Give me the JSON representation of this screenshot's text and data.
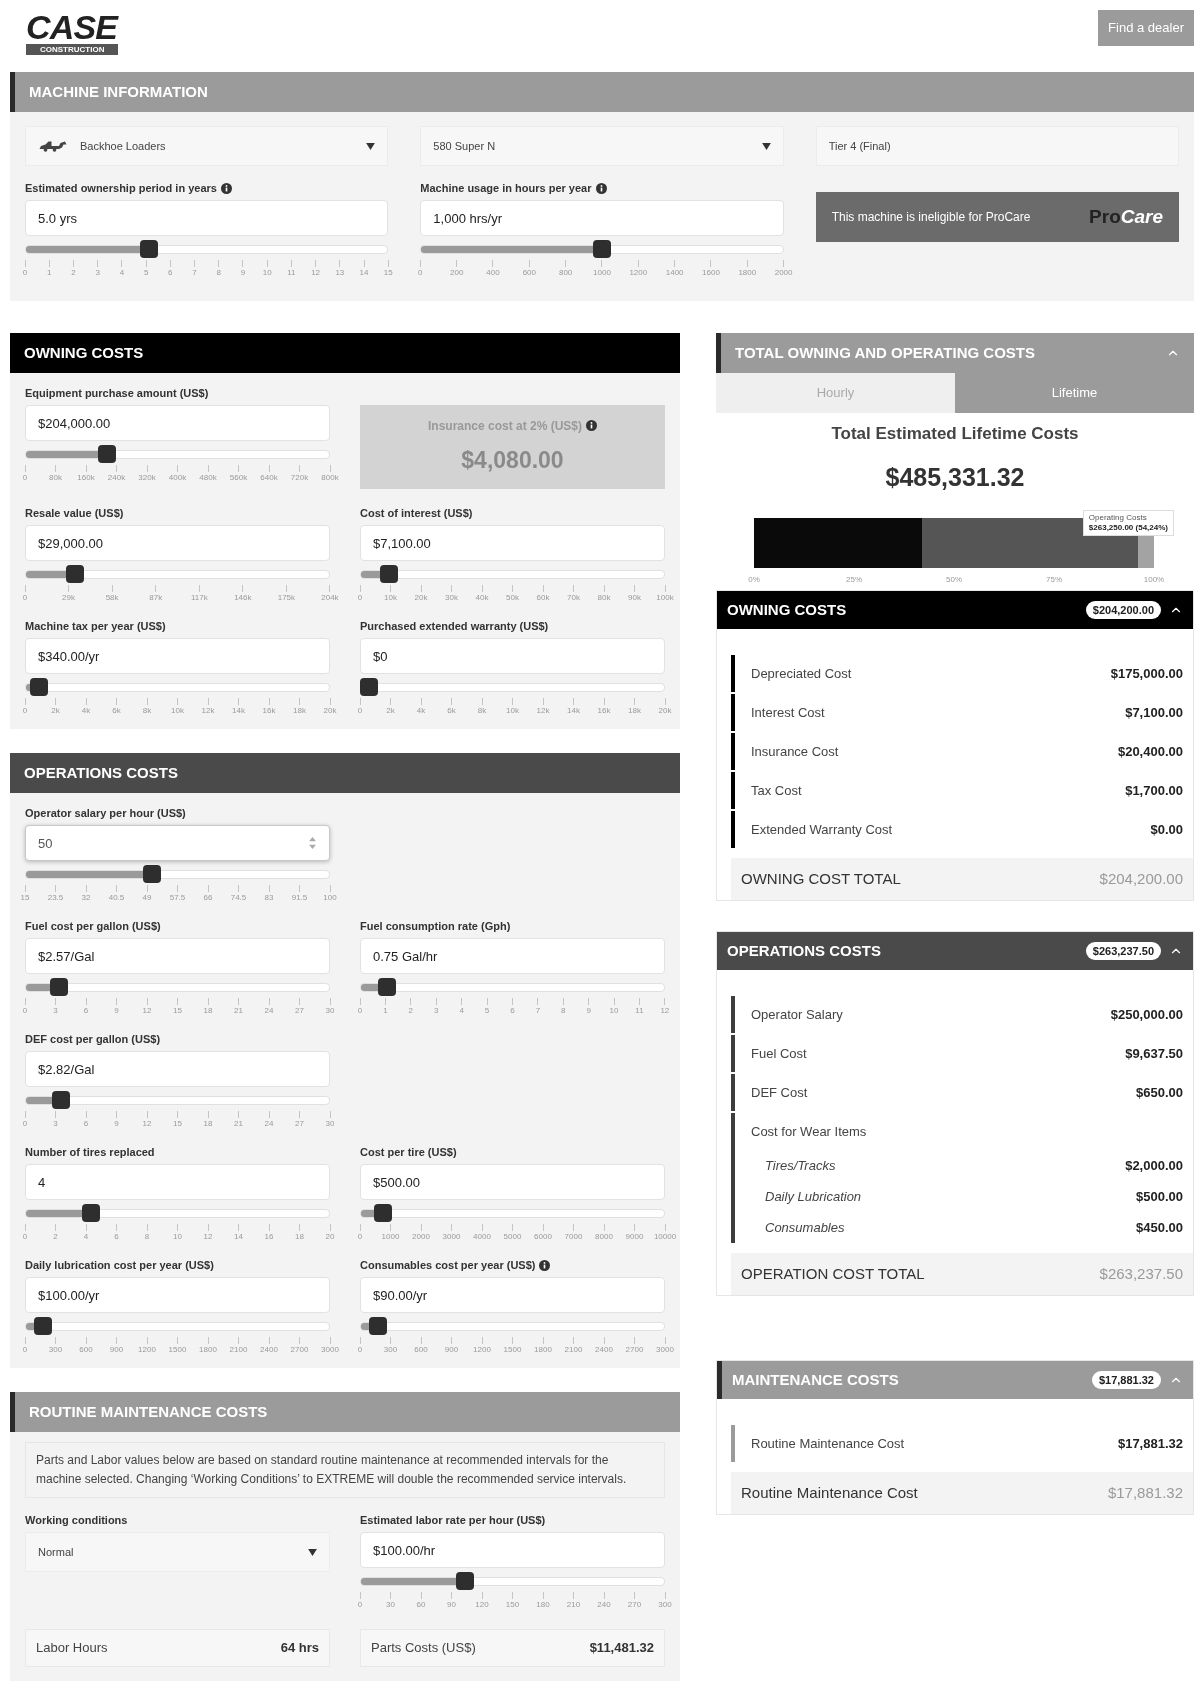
{
  "header": {
    "logo": {
      "name": "CASE",
      "tagline": "CONSTRUCTION"
    },
    "dealer_button": "Find a dealer"
  },
  "machine_information": {
    "title": "MACHINE INFORMATION",
    "kind": "gray",
    "selects": [
      {
        "kind": "category",
        "value": "Backhoe Loaders"
      },
      {
        "kind": "dropdown",
        "value": "580 Super N"
      },
      {
        "kind": "display",
        "value": "Tier 4 (Final)"
      }
    ],
    "fields": [
      {
        "kind": "text",
        "label": "Estimated ownership period in years",
        "info": true,
        "value": "5.0 yrs",
        "level": 0.333,
        "ticks": [
          "0",
          "1",
          "2",
          "3",
          "4",
          "5",
          "6",
          "7",
          "8",
          "9",
          "10",
          "11",
          "12",
          "13",
          "14",
          "15"
        ]
      },
      {
        "kind": "text",
        "label": "Machine usage in hours per year",
        "info": true,
        "value": "1,000 hrs/yr",
        "level": 0.5,
        "ticks": [
          "0",
          "200",
          "400",
          "600",
          "800",
          "1000",
          "1200",
          "1400",
          "1600",
          "1800",
          "2000"
        ]
      }
    ],
    "procare": {
      "message": "This machine is ineligible for ProCare",
      "logo_first": "Pro",
      "logo_second": "Care"
    }
  },
  "owning_costs": {
    "title": "OWNING COSTS",
    "kind": "black",
    "rows": [
      [
        {
          "kind": "text",
          "label": "Equipment purchase amount (US$)",
          "info": false,
          "value": "$204,000.00",
          "level": 0.255,
          "ticks": [
            "0",
            "80k",
            "160k",
            "240k",
            "320k",
            "400k",
            "480k",
            "560k",
            "640k",
            "720k",
            "800k"
          ]
        },
        {
          "kind": "insurance",
          "label": "Insurance cost at 2% (US$)",
          "info": true,
          "amount": "$4,080.00"
        }
      ],
      [
        {
          "kind": "text",
          "label": "Resale value (US$)",
          "info": false,
          "value": "$29,000.00",
          "level": 0.142,
          "ticks": [
            "0",
            "29k",
            "58k",
            "87k",
            "117k",
            "146k",
            "175k",
            "204k"
          ]
        },
        {
          "kind": "text",
          "label": "Cost of interest (US$)",
          "info": false,
          "value": "$7,100.00",
          "level": 0.071,
          "ticks": [
            "0",
            "10k",
            "20k",
            "30k",
            "40k",
            "50k",
            "60k",
            "70k",
            "80k",
            "90k",
            "100k"
          ]
        }
      ],
      [
        {
          "kind": "text",
          "label": "Machine tax per year (US$)",
          "info": false,
          "value": "$340.00/yr",
          "level": 0.017,
          "ticks": [
            "0",
            "2k",
            "4k",
            "6k",
            "8k",
            "10k",
            "12k",
            "14k",
            "16k",
            "18k",
            "20k"
          ]
        },
        {
          "kind": "text",
          "label": "Purchased extended warranty (US$)",
          "info": false,
          "value": "$0",
          "level": 0,
          "ticks": [
            "0",
            "2k",
            "4k",
            "6k",
            "8k",
            "10k",
            "12k",
            "14k",
            "16k",
            "18k",
            "20k"
          ]
        }
      ]
    ]
  },
  "operations_costs": {
    "title": "OPERATIONS COSTS",
    "kind": "dark",
    "rows": [
      [
        {
          "kind": "number",
          "label": "Operator salary per hour (US$)",
          "info": false,
          "value": "50",
          "level": 0.41,
          "ticks": [
            "15",
            "23.5",
            "32",
            "40.5",
            "49",
            "57.5",
            "66",
            "74.5",
            "83",
            "91.5",
            "100"
          ]
        }
      ],
      [
        {
          "kind": "text",
          "label": "Fuel cost per gallon (US$)",
          "info": false,
          "value": "$2.57/Gal",
          "level": 0.086,
          "ticks": [
            "0",
            "3",
            "6",
            "9",
            "12",
            "15",
            "18",
            "21",
            "24",
            "27",
            "30"
          ]
        },
        {
          "kind": "text",
          "label": "Fuel consumption rate (Gph)",
          "info": false,
          "value": "0.75 Gal/hr",
          "level": 0.0625,
          "ticks": [
            "0",
            "1",
            "2",
            "3",
            "4",
            "5",
            "6",
            "7",
            "8",
            "9",
            "10",
            "11",
            "12"
          ]
        }
      ],
      [
        {
          "kind": "text",
          "label": "DEF cost per gallon (US$)",
          "info": false,
          "value": "$2.82/Gal",
          "level": 0.094,
          "ticks": [
            "0",
            "3",
            "6",
            "9",
            "12",
            "15",
            "18",
            "21",
            "24",
            "27",
            "30"
          ]
        }
      ],
      [
        {
          "kind": "text",
          "label": "Number of tires replaced",
          "info": false,
          "value": "4",
          "level": 0.2,
          "ticks": [
            "0",
            "2",
            "4",
            "6",
            "8",
            "10",
            "12",
            "14",
            "16",
            "18",
            "20"
          ]
        },
        {
          "kind": "text",
          "label": "Cost per tire (US$)",
          "info": false,
          "value": "$500.00",
          "level": 0.05,
          "ticks": [
            "0",
            "1000",
            "2000",
            "3000",
            "4000",
            "5000",
            "6000",
            "7000",
            "8000",
            "9000",
            "10000"
          ]
        }
      ],
      [
        {
          "kind": "text",
          "label": "Daily lubrication cost per year (US$)",
          "info": false,
          "value": "$100.00/yr",
          "level": 0.033,
          "ticks": [
            "0",
            "300",
            "600",
            "900",
            "1200",
            "1500",
            "1800",
            "2100",
            "2400",
            "2700",
            "3000"
          ]
        },
        {
          "kind": "text",
          "label": "Consumables cost per year (US$)",
          "info": true,
          "value": "$90.00/yr",
          "level": 0.03,
          "ticks": [
            "0",
            "300",
            "600",
            "900",
            "1200",
            "1500",
            "1800",
            "2100",
            "2400",
            "2700",
            "3000"
          ]
        }
      ]
    ]
  },
  "routine_maintenance_costs": {
    "title": "ROUTINE MAINTENANCE COSTS",
    "kind": "gray",
    "note": "Parts and Labor values below are based on standard routine maintenance at recommended intervals for the machine selected. Changing ‘Working Conditions’ to EXTREME will double the recommended service intervals.",
    "rows": [
      [
        {
          "kind": "select",
          "label": "Working conditions",
          "info": false,
          "value": "Normal"
        },
        {
          "kind": "text",
          "label": "Estimated labor rate per hour (US$)",
          "info": false,
          "value": "$100.00/hr",
          "level": 0.333,
          "ticks": [
            "0",
            "30",
            "60",
            "90",
            "120",
            "150",
            "180",
            "210",
            "240",
            "270",
            "300"
          ]
        }
      ]
    ],
    "stats": [
      {
        "label": "Labor Hours",
        "value": "64 hrs"
      },
      {
        "label": "Parts Costs (US$)",
        "value": "$11,481.32"
      }
    ]
  },
  "total_costs": {
    "title": "TOTAL OWNING AND OPERATING COSTS",
    "kind": "gray",
    "expanded": true,
    "tabs": [
      {
        "label": "Hourly",
        "selected": false
      },
      {
        "label": "Lifetime",
        "selected": true
      }
    ],
    "heading": "Total Estimated Lifetime Costs",
    "amount": "$485,331.32",
    "chart_data": {
      "type": "bar",
      "orientation": "horizontal",
      "stacked": true,
      "xlim": [
        0,
        100
      ],
      "xticks": [
        {
          "value": 0,
          "label": "0%"
        },
        {
          "value": 25,
          "label": "25%"
        },
        {
          "value": 50,
          "label": "50%"
        },
        {
          "value": 75,
          "label": "75%"
        },
        {
          "value": 100,
          "label": "100%"
        }
      ],
      "series": [
        {
          "color": "#0a0a0a",
          "values": [
            42
          ]
        },
        {
          "color": "#555555",
          "values": [
            54
          ]
        },
        {
          "color": "#a3a3a3",
          "values": [
            4
          ]
        }
      ]
    },
    "tooltip": {
      "title": "Operating Costs",
      "value": "$263,250.00 (54,24%)"
    }
  },
  "summaries": [
    {
      "title": "OWNING COSTS",
      "kind": "black",
      "badge": "$204,200.00",
      "expanded": true,
      "items": [
        {
          "label": "Depreciated Cost",
          "value": "$175,000.00"
        },
        {
          "label": "Interest Cost",
          "value": "$7,100.00"
        },
        {
          "label": "Insurance Cost",
          "value": "$20,400.00"
        },
        {
          "label": "Tax Cost",
          "value": "$1,700.00"
        },
        {
          "label": "Extended Warranty Cost",
          "value": "$0.00"
        }
      ],
      "total": {
        "label": "OWNING COST TOTAL",
        "value": "$204,200.00"
      }
    },
    {
      "title": "OPERATIONS COSTS",
      "kind": "dark",
      "badge": "$263,237.50",
      "expanded": true,
      "items": [
        {
          "label": "Operator Salary",
          "value": "$250,000.00"
        },
        {
          "label": "Fuel Cost",
          "value": "$9,637.50"
        },
        {
          "label": "DEF Cost",
          "value": "$650.00"
        },
        {
          "label": "Cost for Wear Items",
          "children": [
            {
              "label": "Tires/Tracks",
              "value": "$2,000.00"
            },
            {
              "label": "Daily Lubrication",
              "value": "$500.00"
            },
            {
              "label": "Consumables",
              "value": "$450.00"
            }
          ]
        }
      ],
      "total": {
        "label": "OPERATION COST TOTAL",
        "value": "$263,237.50"
      }
    },
    {
      "title": "MAINTENANCE COSTS",
      "kind": "gray",
      "badge": "$17,881.32",
      "expanded": true,
      "items": [
        {
          "label": "Routine Maintenance Cost",
          "value": "$17,881.32"
        }
      ],
      "total": {
        "label": "Routine Maintenance Cost",
        "value": "$17,881.32"
      }
    }
  ]
}
